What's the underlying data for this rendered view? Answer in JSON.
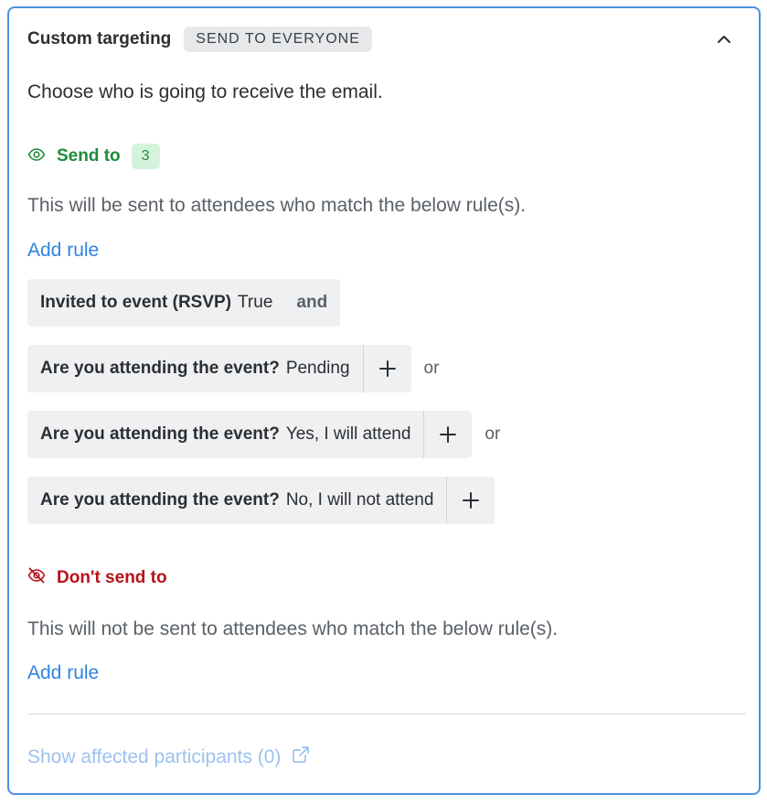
{
  "header": {
    "title": "Custom targeting",
    "badge": "SEND TO EVERYONE"
  },
  "description": "Choose who is going to receive the email.",
  "send_to": {
    "label": "Send to",
    "count": "3",
    "description": "This will be sent to attendees who match the below rule(s).",
    "add_rule": "Add rule",
    "rules": [
      {
        "field": "Invited to event (RSVP)",
        "value": "True",
        "joiner": "and"
      },
      {
        "field": "Are you attending the event?",
        "value": "Pending",
        "joiner": "or"
      },
      {
        "field": "Are you attending the event?",
        "value": "Yes, I will attend",
        "joiner": "or"
      },
      {
        "field": "Are you attending the event?",
        "value": "No, I will not attend",
        "joiner": ""
      }
    ]
  },
  "dont_send_to": {
    "label": "Don't send to",
    "description": "This will not be sent to attendees who match the below rule(s).",
    "add_rule": "Add rule"
  },
  "footer": {
    "link": "Show affected participants (0)"
  },
  "colors": {
    "border": "#4a90e2",
    "send_green": "#1f8a3a",
    "dont_red": "#b8111a",
    "link_blue": "#2f84e0"
  }
}
